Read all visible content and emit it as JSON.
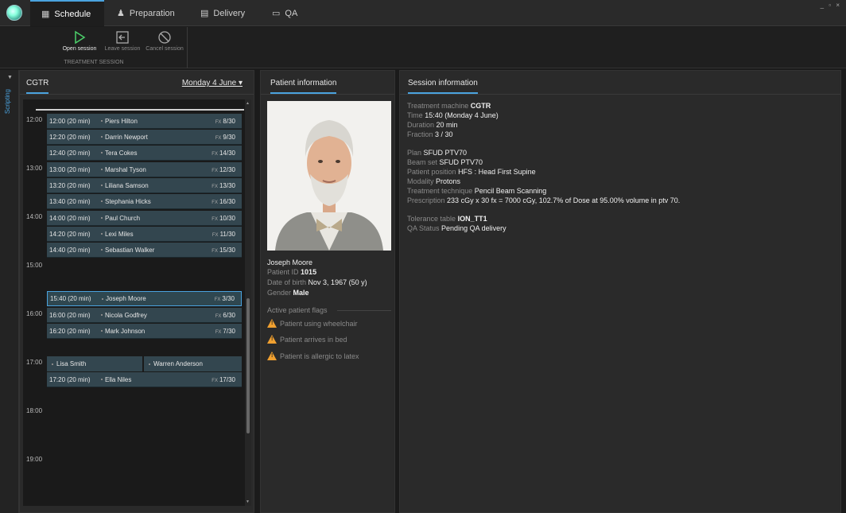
{
  "topbar": {
    "tabs": [
      {
        "label": "Schedule",
        "icon": "calendar-icon",
        "active": true
      },
      {
        "label": "Preparation",
        "icon": "person-icon",
        "active": false
      },
      {
        "label": "Delivery",
        "icon": "delivery-icon",
        "active": false
      },
      {
        "label": "QA",
        "icon": "qa-icon",
        "active": false
      }
    ],
    "window_controls": "_ ▫ ×"
  },
  "ribbon": {
    "group_label": "TREATMENT SESSION",
    "buttons": [
      {
        "label": "Open session",
        "icon": "play-icon",
        "enabled": true
      },
      {
        "label": "Leave session",
        "icon": "exit-icon",
        "enabled": false
      },
      {
        "label": "Cancel session",
        "icon": "cancel-icon",
        "enabled": false
      }
    ]
  },
  "side": {
    "label": "Scripting"
  },
  "schedule": {
    "machine": "CGTR",
    "date": "Monday 4 June ▾",
    "hours": [
      "12:00",
      "13:00",
      "14:00",
      "15:00",
      "16:00",
      "17:00",
      "18:00",
      "19:00"
    ],
    "slots": [
      {
        "time": "12:00 (20 min)",
        "name": "Piers Hilton",
        "fx": "8/30"
      },
      {
        "time": "12:20 (20 min)",
        "name": "Darrin Newport",
        "fx": "9/30"
      },
      {
        "time": "12:40 (20 min)",
        "name": "Tera Cokes",
        "fx": "14/30"
      },
      {
        "time": "13:00 (20 min)",
        "name": "Marshal Tyson",
        "fx": "12/30"
      },
      {
        "time": "13:20 (20 min)",
        "name": "Liliana Samson",
        "fx": "13/30"
      },
      {
        "time": "13:40 (20 min)",
        "name": "Stephania Hicks",
        "fx": "16/30"
      },
      {
        "time": "14:00 (20 min)",
        "name": "Paul Church",
        "fx": "10/30"
      },
      {
        "time": "14:20 (20 min)",
        "name": "Lexi Miles",
        "fx": "11/30"
      },
      {
        "time": "14:40 (20 min)",
        "name": "Sebastian Walker",
        "fx": "15/30"
      },
      {
        "time": "15:40 (20 min)",
        "name": "Joseph Moore",
        "fx": "3/30"
      },
      {
        "time": "16:00 (20 min)",
        "name": "Nicola Godfrey",
        "fx": "6/30"
      },
      {
        "time": "16:20 (20 min)",
        "name": "Mark Johnson",
        "fx": "7/30"
      },
      {
        "time": "17:20 (20 min)",
        "name": "Ella Niles",
        "fx": "17/30"
      }
    ],
    "split_slot": {
      "left": "Lisa Smith",
      "right": "Warren Anderson"
    },
    "fx_prefix": "FX"
  },
  "patient": {
    "title": "Patient information",
    "name": "Joseph Moore",
    "id_label": "Patient ID",
    "id": "1015",
    "dob_label": "Date of birth",
    "dob": "Nov 3, 1967 (50 y)",
    "gender_label": "Gender",
    "gender": "Male",
    "flags_title": "Active patient flags",
    "flags": [
      "Patient using wheelchair",
      "Patient arrives in bed",
      "Patient is allergic to latex"
    ],
    "warn_color": "#f0a030"
  },
  "session": {
    "title": "Session information",
    "machine_label": "Treatment machine",
    "machine": "CGTR",
    "time_label": "Time",
    "time": "15:40 (Monday 4 June)",
    "duration_label": "Duration",
    "duration": "20 min",
    "fraction_label": "Fraction",
    "fraction": "3 / 30",
    "plan_label": "Plan",
    "plan": "SFUD PTV70",
    "beamset_label": "Beam set",
    "beamset": "SFUD PTV70",
    "position_label": "Patient position",
    "position": "HFS : Head First Supine",
    "modality_label": "Modality",
    "modality": "Protons",
    "technique_label": "Treatment technique",
    "technique": "Pencil Beam Scanning",
    "prescription_label": "Prescription",
    "prescription": "233 cGy x 30 fx = 7000 cGy, 102.7% of Dose at 95.00% volume in ptv 70.",
    "tolerance_label": "Tolerance table",
    "tolerance": "ION_TT1",
    "qa_label": "QA Status",
    "qa": "Pending QA delivery"
  },
  "colors": {
    "accent": "#4aa3df",
    "slot_bg": "#33464f"
  }
}
